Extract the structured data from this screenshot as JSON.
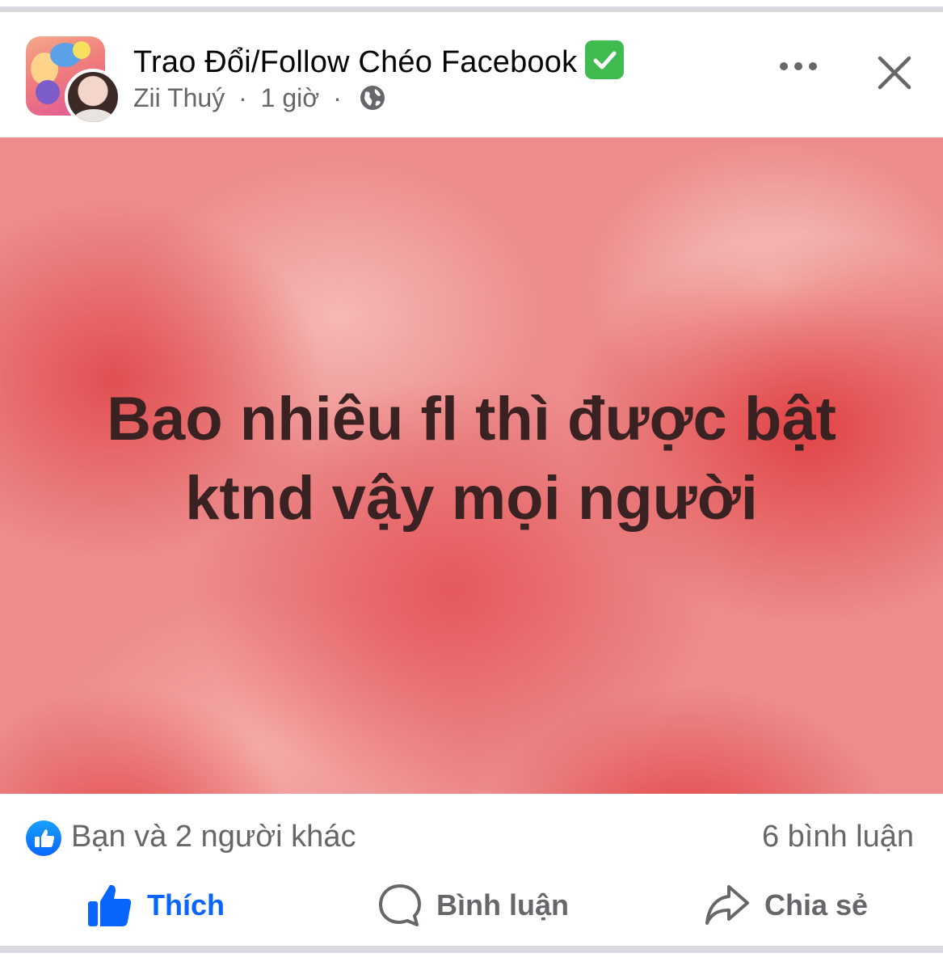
{
  "header": {
    "group_name": "Trao Đổi/Follow Chéo Facebook",
    "author": "Zii Thuý",
    "separator": "·",
    "time": "1 giờ",
    "icons": [
      "group-avatar",
      "user-avatar",
      "verified-check-icon",
      "globe-icon",
      "more-icon",
      "close-icon"
    ]
  },
  "post": {
    "text": "Bao nhiêu fl thì được bật ktnd vậy mọi người"
  },
  "reactions": {
    "summary": "Bạn và 2 người khác",
    "comments": "6 bình luận"
  },
  "actions": {
    "like": "Thích",
    "comment": "Bình luận",
    "share": "Chia sẻ"
  },
  "colors": {
    "accent": "#0866ff",
    "secondary_text": "#65676b",
    "verified": "#3fbb4f",
    "post_background": "#ec8c8c",
    "post_text": "#3a2222"
  }
}
